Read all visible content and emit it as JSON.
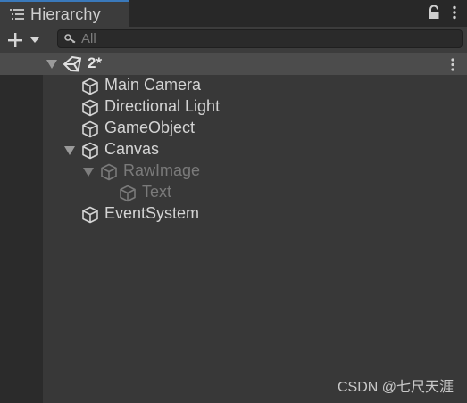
{
  "panel": {
    "title": "Hierarchy"
  },
  "search": {
    "placeholder": "All",
    "value": ""
  },
  "scene": {
    "name": "2*"
  },
  "items": [
    {
      "label": "Main Camera",
      "active": true
    },
    {
      "label": "Directional Light",
      "active": true
    },
    {
      "label": "GameObject",
      "active": true
    },
    {
      "label": "Canvas",
      "active": true,
      "expanded": true
    },
    {
      "label": "RawImage",
      "active": false,
      "expanded": true
    },
    {
      "label": "Text",
      "active": false
    },
    {
      "label": "EventSystem",
      "active": true
    }
  ],
  "watermark": "CSDN @七尺天涯",
  "icons": {
    "tab": "list-icon",
    "lock": "lock-icon",
    "menu": "kebab-menu-icon",
    "add": "plus-icon",
    "search": "search-icon",
    "scene": "unity-logo-icon",
    "gameobject": "cube-icon"
  },
  "colors": {
    "background": "#383838",
    "tab_accent": "#3a79bb",
    "scene_row": "#4c4c4c",
    "text": "#d4d4d4",
    "inactive_text": "#7a7a7a"
  }
}
